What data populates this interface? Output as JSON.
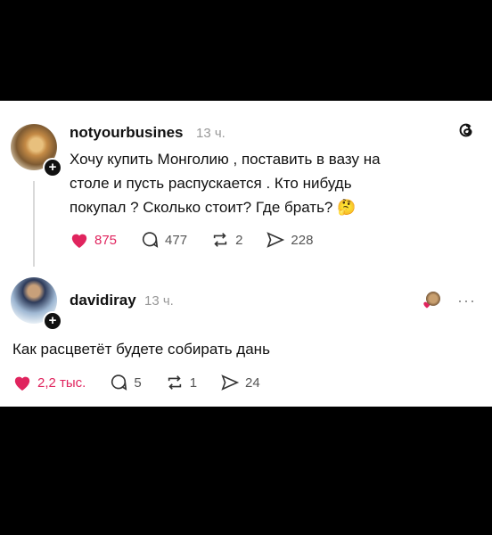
{
  "post1": {
    "username": "notyourbusines",
    "time": "13 ч.",
    "text_line1": "Хочу купить Монголию , поставить в вазу на",
    "text_line2": "столе и пусть распускается . Кто нибудь",
    "text_line3": "покупал ? Сколько стоит? Где брать? 🤔",
    "likes": "875",
    "comments": "477",
    "reposts": "2",
    "shares": "228"
  },
  "post2": {
    "username": "davidiray",
    "time": "13 ч.",
    "text": "Как расцветёт будете собирать дань",
    "likes": "2,2 тыс.",
    "comments": "5",
    "reposts": "1",
    "shares": "24",
    "more_label": "···"
  },
  "colors": {
    "like": "#e0245e",
    "text": "#111111",
    "muted": "#999999"
  },
  "icons": [
    "heart-icon",
    "comment-icon",
    "repost-icon",
    "share-icon",
    "threads-logo-icon",
    "plus-icon"
  ]
}
